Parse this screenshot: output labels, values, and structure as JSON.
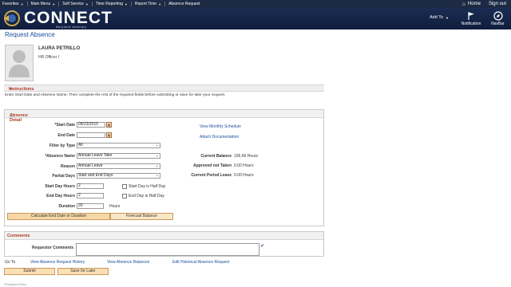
{
  "topnav": {
    "items": [
      "Favorites",
      "Main Menu",
      "Self Service",
      "Time Reporting",
      "Report Time",
      "Absence Request"
    ],
    "home": "Home",
    "signout": "Sign out"
  },
  "header": {
    "logo": "CONNECT",
    "logo_sub": "Maryland Judiciary",
    "add_to": "Add To",
    "notification": "Notification",
    "navbar": "NavBar"
  },
  "page": {
    "title": "Request Absence"
  },
  "employee": {
    "name": "LAURA PETRILLO",
    "title": "HR Officer I"
  },
  "instructions": {
    "heading": "Instructions",
    "text": "Enter Start Date and Absence Name. Then complete the rest of the required fields before submitting or save for later your request."
  },
  "detail": {
    "heading": "Absence Detail",
    "start_date_label": "*Start Date",
    "start_date": "09/23/2015",
    "end_date_label": "End Date",
    "end_date": "",
    "filter_label": "Filter by Type",
    "filter_value": "All",
    "absence_name_label": "*Absence Name",
    "absence_name": "Annual Leave Take",
    "reason_label": "Reason",
    "reason": "Annual Leave",
    "partial_days_label": "Partial Days",
    "partial_days": "Start and End Days",
    "start_day_hours_label": "Start Day Hours",
    "start_day_hours": "2",
    "end_day_hours_label": "End Day Hours",
    "end_day_hours": "2",
    "duration_label": "Duration",
    "duration": "20",
    "duration_unit": "Hours",
    "start_half_day": "Start Day is Half Day",
    "end_half_day": "End Day is Half Day",
    "calc_button": "Calculate End Date or Duration",
    "forecast_button": "Forecast Balance",
    "view_schedule": "View Monthly Schedule",
    "attach_doc": "Attach Documentation",
    "current_balance_label": "Current Balance",
    "current_balance": "106.66 Hours",
    "approved_label": "Approved not Taken",
    "approved": "0.00 Hours",
    "period_leave_label": "Current Period Leave",
    "period_leave": "0.00 Hours"
  },
  "comments": {
    "heading": "Comments",
    "requestor_label": "Requestor Comments",
    "requestor_value": ""
  },
  "goto": {
    "label": "Go To",
    "links": [
      "View Absence Request History",
      "View Absence Balances",
      "Edit Historical Absence Request"
    ]
  },
  "actions": {
    "submit": "Submit",
    "save_later": "Save for Later"
  },
  "footer": {
    "note": "*Required Field"
  },
  "colors": {
    "nav_bg": "#1d2a44",
    "header_bg": "#1a2c52",
    "link": "#1a4e9c",
    "section_heading": "#b13a24",
    "button": "#f6d8a8"
  }
}
